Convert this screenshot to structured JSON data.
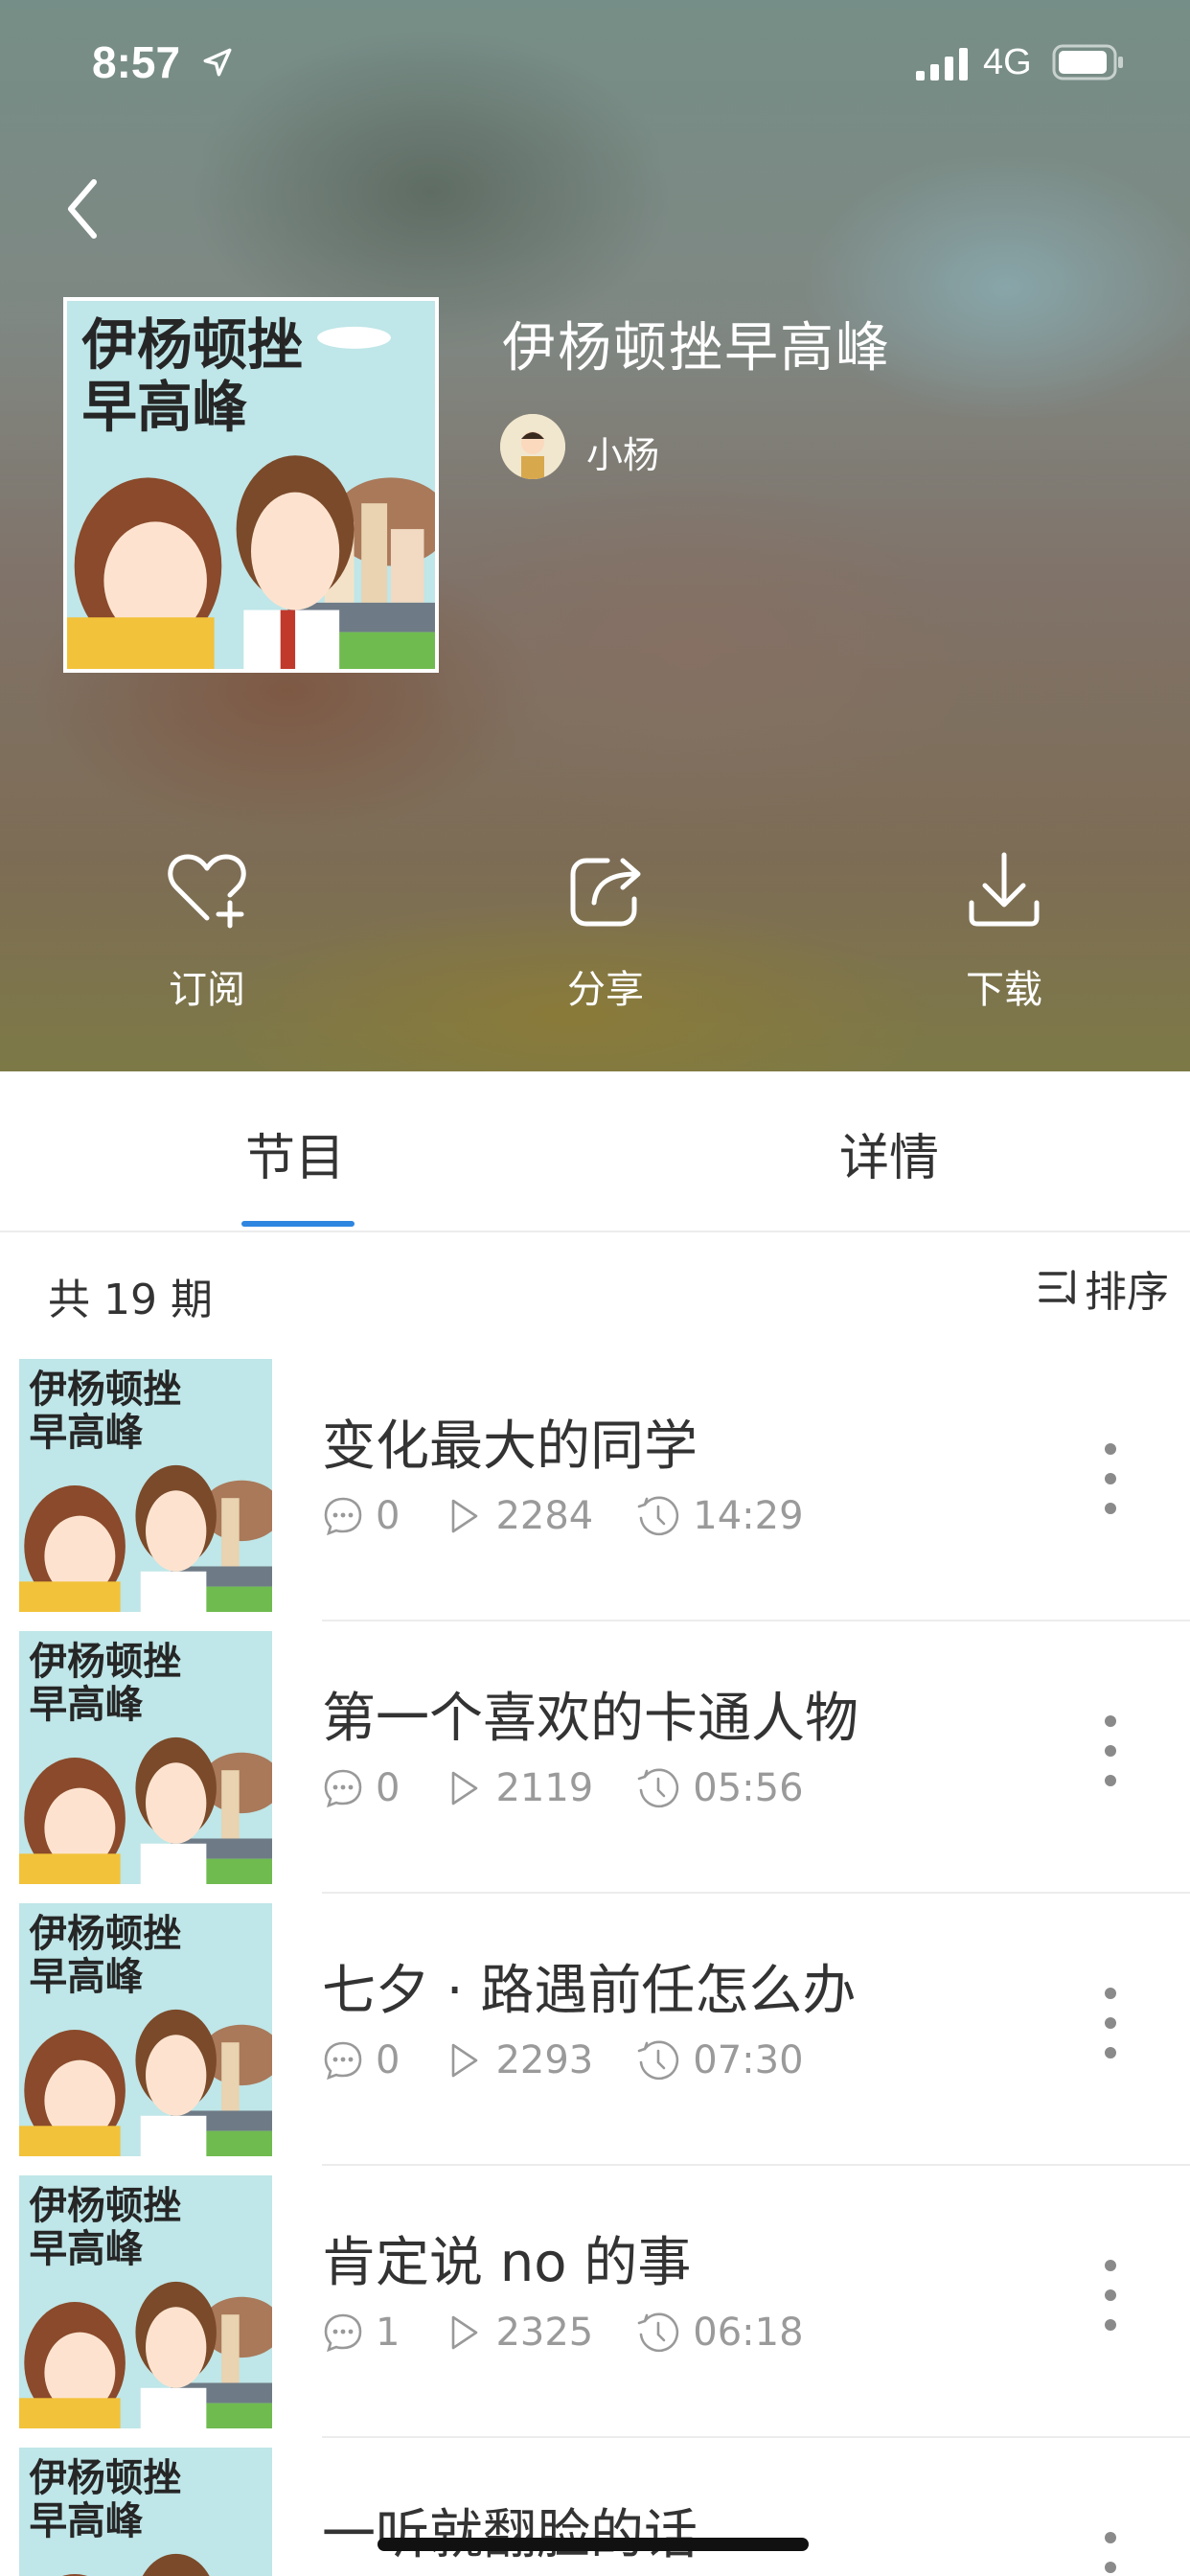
{
  "status_bar": {
    "time": "8:57",
    "network": "4G"
  },
  "album": {
    "title": "伊杨顿挫早高峰",
    "author": "小杨",
    "cover_text_line1": "伊杨顿挫",
    "cover_text_line2": "早高峰"
  },
  "actions": [
    {
      "label": "订阅",
      "icon": "heart-plus-icon"
    },
    {
      "label": "分享",
      "icon": "share-icon"
    },
    {
      "label": "下载",
      "icon": "download-icon"
    }
  ],
  "tabs": [
    {
      "label": "节目",
      "active": true
    },
    {
      "label": "详情",
      "active": false
    }
  ],
  "list_header": {
    "count": "共 19 期",
    "sort_label": "排序"
  },
  "episodes": [
    {
      "title": "变化最大的同学",
      "comments": "0",
      "plays": "2284",
      "duration": "14:29"
    },
    {
      "title": "第一个喜欢的卡通人物",
      "comments": "0",
      "plays": "2119",
      "duration": "05:56"
    },
    {
      "title": "七夕 · 路遇前任怎么办",
      "comments": "0",
      "plays": "2293",
      "duration": "07:30"
    },
    {
      "title": "肯定说 no 的事",
      "comments": "1",
      "plays": "2325",
      "duration": "06:18"
    },
    {
      "title": "一听就翻脸的话",
      "comments": "",
      "plays": "",
      "duration": ""
    }
  ],
  "colors": {
    "accent": "#2f86e0",
    "meta_gray": "#9a9a9a",
    "cover_bg": "#bde5e6"
  }
}
